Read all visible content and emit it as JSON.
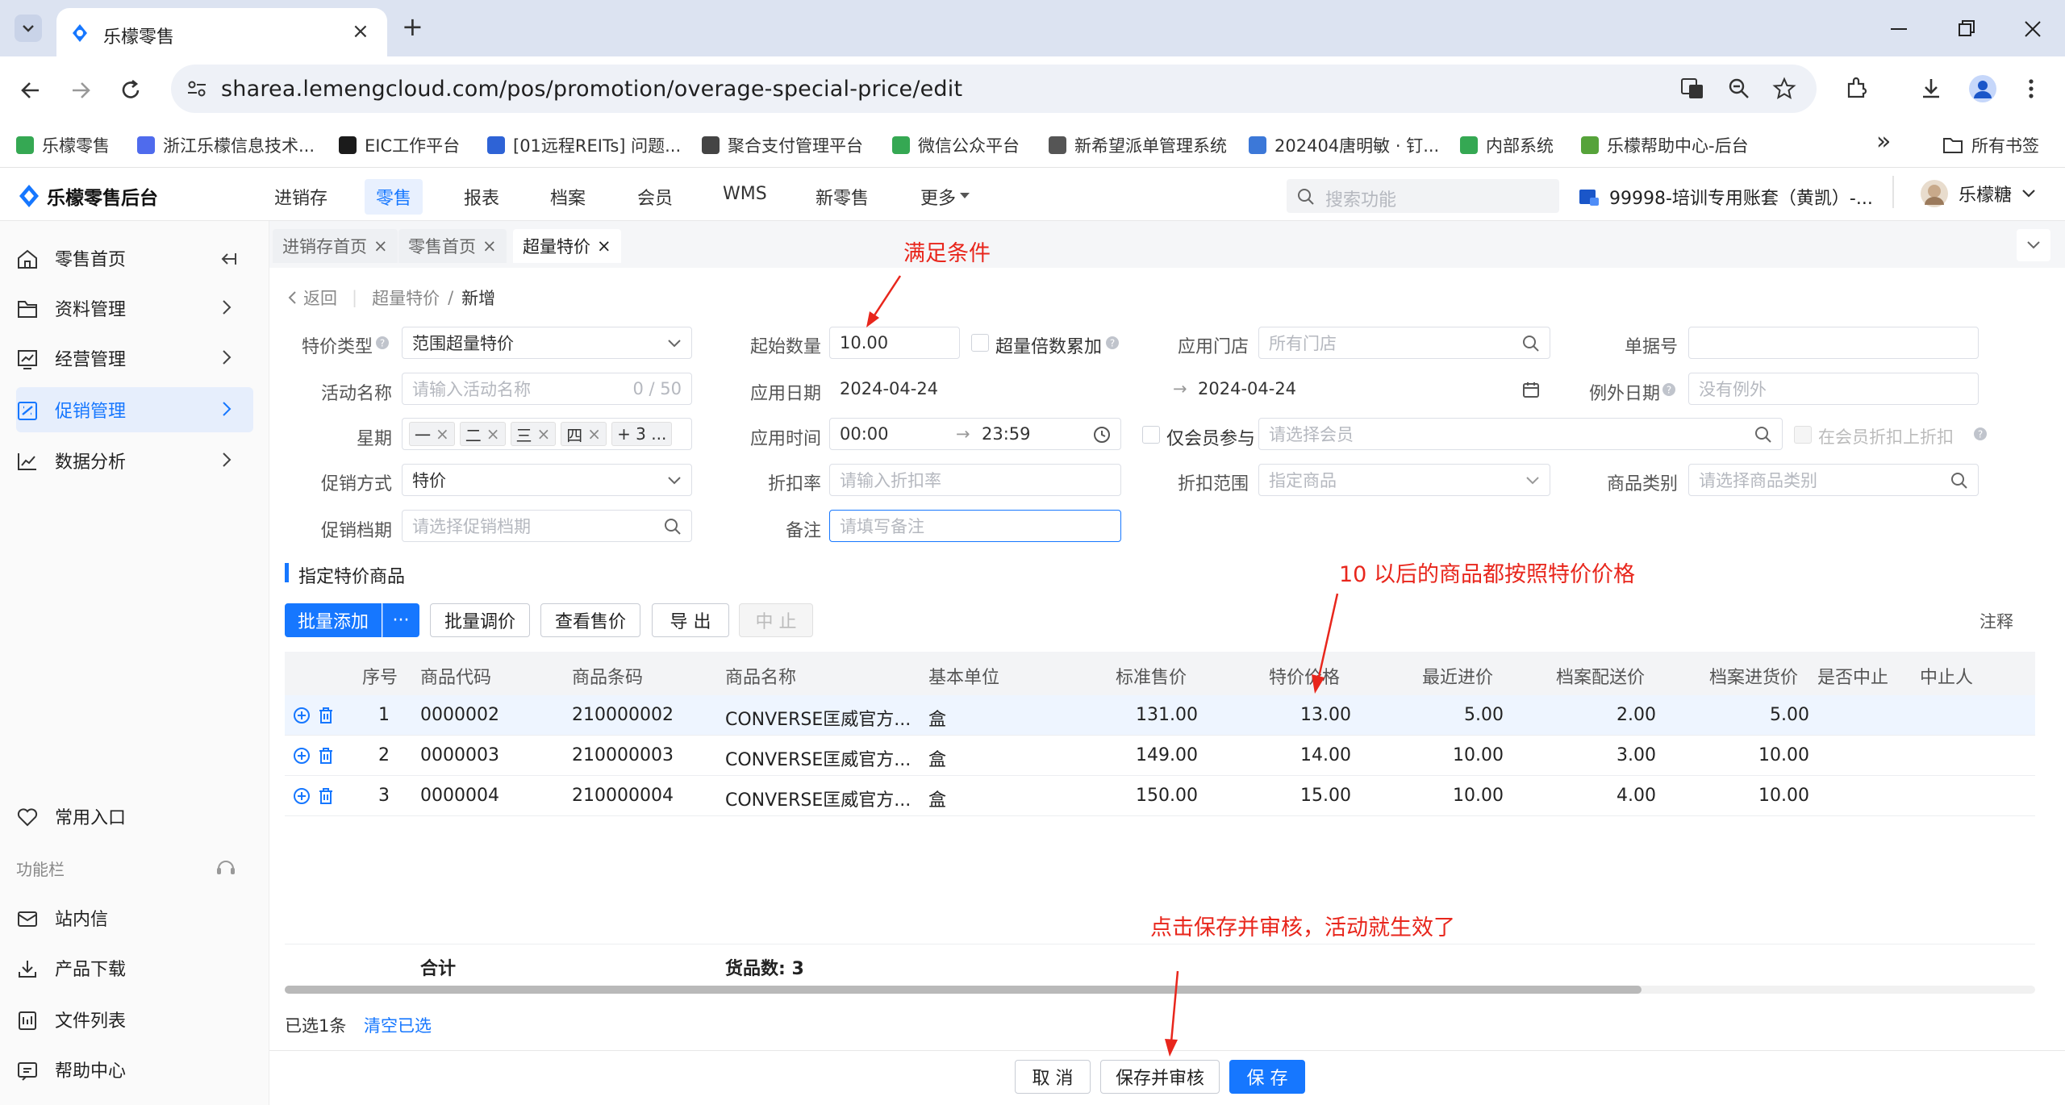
{
  "browser": {
    "tab_title": "乐檬零售",
    "tab_close": "×",
    "new_tab": "+",
    "url": "sharea.lemengcloud.com/pos/promotion/overage-special-price/edit",
    "bookmarks": [
      {
        "label": "乐檬零售",
        "color": "#35a853"
      },
      {
        "label": "浙江乐檬信息技术...",
        "color": "#4f6bed"
      },
      {
        "label": "EIC工作平台",
        "color": "#1b1b1b"
      },
      {
        "label": "[01远程REITs] 问题...",
        "color": "#2e63d6"
      },
      {
        "label": "聚合支付管理平台",
        "color": "#444444"
      },
      {
        "label": "微信公众平台",
        "color": "#35a853"
      },
      {
        "label": "新希望派单管理系统",
        "color": "#555555"
      },
      {
        "label": "202404唐明敏 · 钉...",
        "color": "#3c78d8"
      },
      {
        "label": "内部系统",
        "color": "#35a853"
      },
      {
        "label": "乐檬帮助中心-后台",
        "color": "#56a33a"
      }
    ],
    "more_bookmarks": "»",
    "all_bookmarks": "所有书签"
  },
  "header": {
    "logo_text": "乐檬零售后台",
    "nav": [
      "进销存",
      "零售",
      "报表",
      "档案",
      "会员",
      "WMS",
      "新零售",
      "更多"
    ],
    "active_nav": "零售",
    "search_placeholder": "搜索功能",
    "account": "99998-培训专用账套（黄凯）-...",
    "user": "乐檬糖"
  },
  "sidebar": {
    "items": [
      {
        "label": "零售首页",
        "icon": "home-icon"
      },
      {
        "label": "资料管理",
        "icon": "folder-icon"
      },
      {
        "label": "经营管理",
        "icon": "chart-board-icon"
      },
      {
        "label": "促销管理",
        "icon": "promotion-icon"
      },
      {
        "label": "数据分析",
        "icon": "trend-icon"
      }
    ],
    "common_entry": "常用入口",
    "toolbar_title": "功能栏",
    "tools": [
      {
        "label": "站内信",
        "icon": "mail-icon"
      },
      {
        "label": "产品下载",
        "icon": "download-icon"
      },
      {
        "label": "文件列表",
        "icon": "file-list-icon"
      },
      {
        "label": "帮助中心",
        "icon": "help-icon"
      }
    ]
  },
  "page_tabs": [
    {
      "label": "进销存首页",
      "close": "×"
    },
    {
      "label": "零售首页",
      "close": "×"
    },
    {
      "label": "超量特价",
      "close": "×"
    }
  ],
  "breadcrumb": {
    "back": "返回",
    "parent": "超量特价",
    "sep": "/",
    "current": "新增"
  },
  "form": {
    "special_type": {
      "label": "特价类型",
      "value": "范围超量特价"
    },
    "activity_name": {
      "label": "活动名称",
      "placeholder": "请输入活动名称",
      "counter": "0 / 50"
    },
    "weekday": {
      "label": "星期",
      "tags": [
        "一",
        "二",
        "三",
        "四"
      ],
      "more": "+ 3 ..."
    },
    "promo_method": {
      "label": "促销方式",
      "value": "特价"
    },
    "promo_level": {
      "label": "促销档期",
      "placeholder": "请选择促销档期"
    },
    "start_qty": {
      "label": "起始数量",
      "value": "10.00"
    },
    "multiple_accumulate": "超量倍数累加",
    "apply_date": {
      "label": "应用日期",
      "from": "2024-04-24",
      "arrow": "→",
      "to": "2024-04-24"
    },
    "apply_time": {
      "label": "应用时间",
      "from": "00:00",
      "arrow": "→",
      "to": "23:59"
    },
    "discount_rate": {
      "label": "折扣率",
      "placeholder": "请输入折扣率"
    },
    "remark": {
      "label": "备注",
      "placeholder": "请填写备注"
    },
    "apply_store": {
      "label": "应用门店",
      "placeholder": "所有门店"
    },
    "member_only": "仅会员参与",
    "member_placeholder": "请选择会员",
    "member_discount": "在会员折扣上折扣",
    "discount_scope": {
      "label": "折扣范围",
      "value": "指定商品"
    },
    "doc_no": {
      "label": "单据号",
      "value": ""
    },
    "exception_date": {
      "label": "例外日期",
      "placeholder": "没有例外"
    },
    "product_category": {
      "label": "商品类别",
      "placeholder": "请选择商品类别"
    }
  },
  "section_title": "指定特价商品",
  "toolbar_buttons": {
    "batch_add": "批量添加",
    "more": "···",
    "batch_adjust": "批量调价",
    "view_price": "查看售价",
    "export": "导 出",
    "stop": "中 止",
    "note": "注释"
  },
  "table": {
    "columns": [
      "序号",
      "商品代码",
      "商品条码",
      "商品名称",
      "基本单位",
      "标准售价",
      "特价价格",
      "最近进价",
      "档案配送价",
      "档案进货价",
      "是否中止",
      "中止人"
    ],
    "rows": [
      [
        "1",
        "0000002",
        "210000002",
        "CONVERSE匡威官方...",
        "盒",
        "131.00",
        "13.00",
        "5.00",
        "2.00",
        "5.00",
        "",
        ""
      ],
      [
        "2",
        "0000003",
        "210000003",
        "CONVERSE匡威官方...",
        "盒",
        "149.00",
        "14.00",
        "10.00",
        "3.00",
        "10.00",
        "",
        ""
      ],
      [
        "3",
        "0000004",
        "210000004",
        "CONVERSE匡威官方...",
        "盒",
        "150.00",
        "15.00",
        "10.00",
        "4.00",
        "10.00",
        "",
        ""
      ]
    ],
    "total_label": "合计",
    "goods_count": "货品数: 3"
  },
  "selection": {
    "selected": "已选1条",
    "clear": "清空已选"
  },
  "footer_buttons": {
    "cancel": "取 消",
    "save_audit": "保存并审核",
    "save": "保 存"
  },
  "annotations": {
    "condition": "满足条件",
    "after_ten": "10 以后的商品都按照特价价格",
    "click_save": "点击保存并审核，活动就生效了"
  },
  "colors": {
    "accent": "#1677ff",
    "annotation": "#e8261c"
  }
}
